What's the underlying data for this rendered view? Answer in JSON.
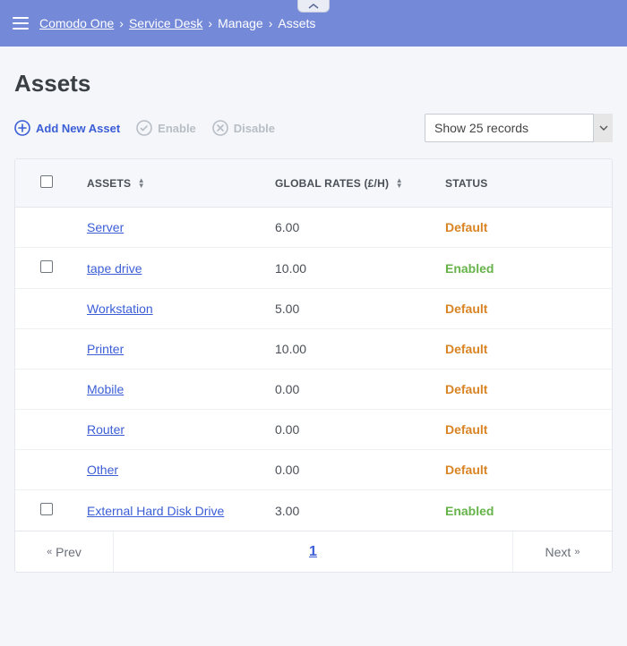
{
  "breadcrumb": {
    "home": "Comodo One",
    "svc": "Service Desk",
    "manage": "Manage",
    "current": "Assets"
  },
  "page": {
    "title": "Assets"
  },
  "toolbar": {
    "add_label": "Add New Asset",
    "enable_label": "Enable",
    "disable_label": "Disable",
    "records_selected": "Show 25 records"
  },
  "table": {
    "headers": {
      "assets": "ASSETS",
      "rates": "GLOBAL RATES (£/H)",
      "status": "STATUS"
    },
    "rows": [
      {
        "name": "Server",
        "rate": "6.00",
        "status": "Default",
        "show_checkbox": false
      },
      {
        "name": "tape drive",
        "rate": "10.00",
        "status": "Enabled",
        "show_checkbox": true
      },
      {
        "name": "Workstation",
        "rate": "5.00",
        "status": "Default",
        "show_checkbox": false
      },
      {
        "name": "Printer",
        "rate": "10.00",
        "status": "Default",
        "show_checkbox": false
      },
      {
        "name": "Mobile",
        "rate": "0.00",
        "status": "Default",
        "show_checkbox": false
      },
      {
        "name": "Router",
        "rate": "0.00",
        "status": "Default",
        "show_checkbox": false
      },
      {
        "name": "Other",
        "rate": "0.00",
        "status": "Default",
        "show_checkbox": false
      },
      {
        "name": "External Hard Disk Drive",
        "rate": "3.00",
        "status": "Enabled",
        "show_checkbox": true
      }
    ]
  },
  "pager": {
    "prev": "Prev",
    "next": "Next",
    "current_page": "1"
  }
}
